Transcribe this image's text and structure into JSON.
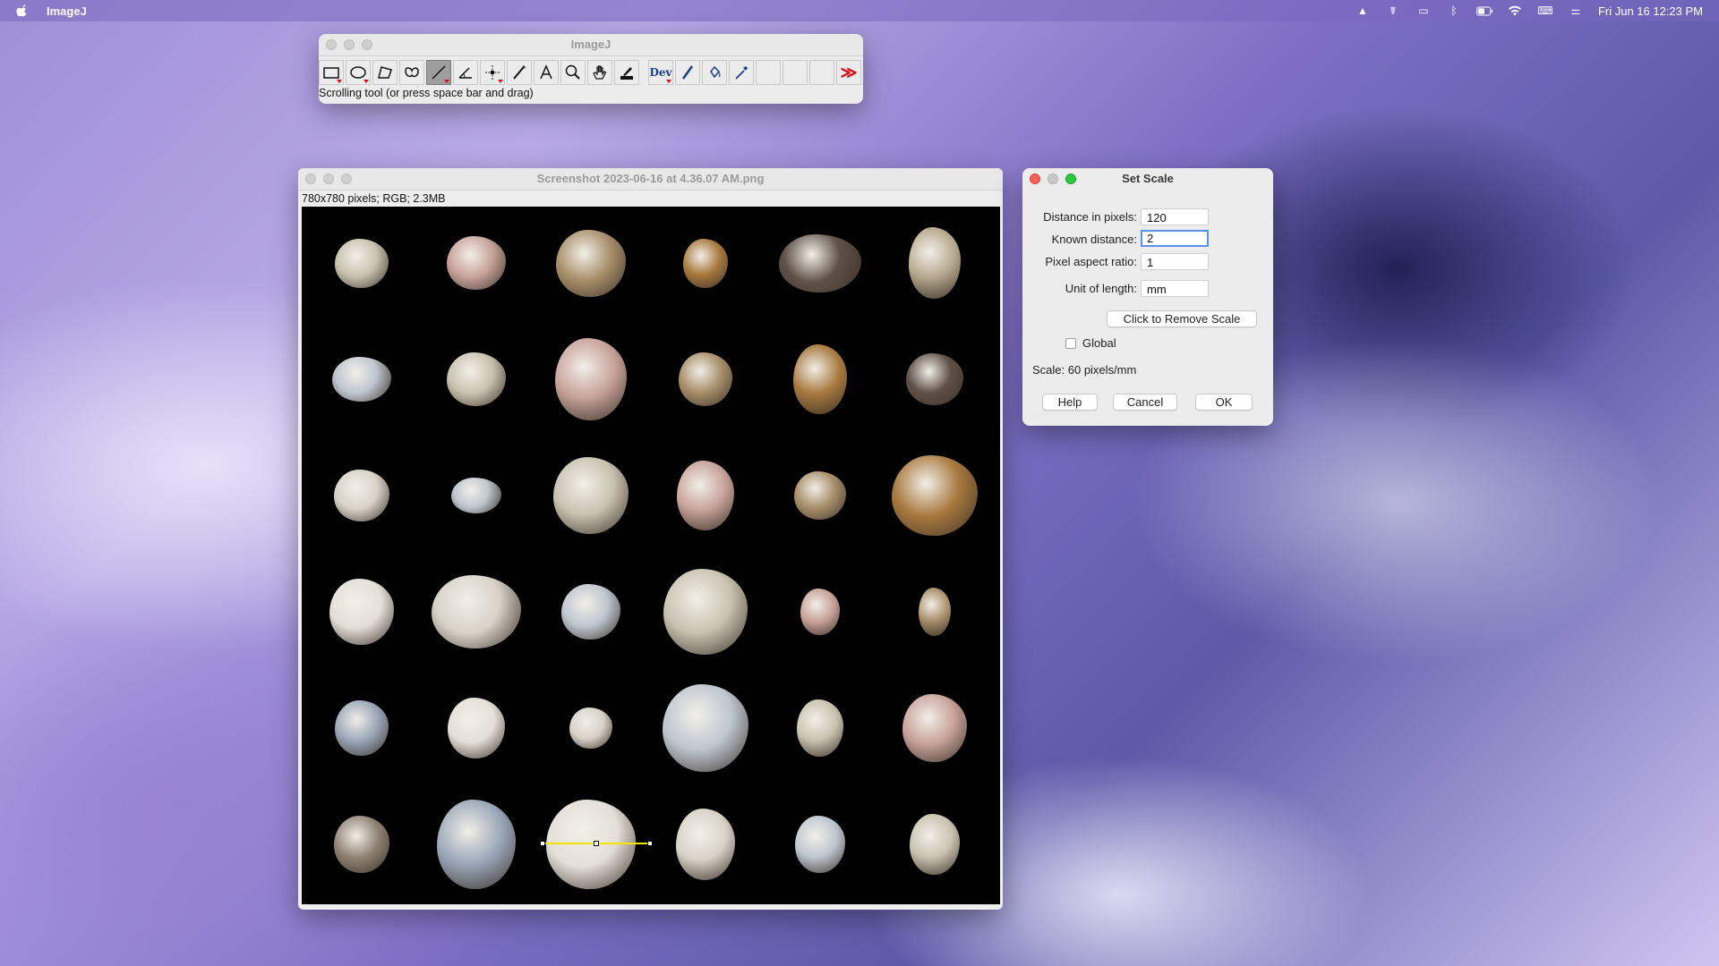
{
  "menubar": {
    "app_name": "ImageJ",
    "clock": "Fri Jun 16  12:23 PM",
    "icons": [
      "scale-icon",
      "spotlight-person-icon",
      "display-icon",
      "bluetooth-icon",
      "battery-icon",
      "wifi-icon",
      "keyboard-icon",
      "control-center-icon"
    ]
  },
  "toolbar_window": {
    "title": "ImageJ",
    "dev_label": "Dev",
    "more_label": "≫",
    "status": "Scrolling tool (or press space bar and drag)",
    "tools": [
      "rectangle-tool",
      "oval-tool",
      "polygon-tool",
      "freehand-tool",
      "line-tool",
      "angle-tool",
      "point-tool",
      "wand-tool",
      "text-tool",
      "magnifier-tool",
      "hand-tool",
      "color-picker-tool",
      "dev-tool",
      "brush-tool",
      "flood-fill-tool",
      "pipette-tool",
      "empty-slot",
      "empty-slot",
      "empty-slot",
      "more-tools"
    ]
  },
  "image_window": {
    "title": "Screenshot 2023-06-16 at 4.36.07 AM.png",
    "info": "780x780 pixels; RGB; 2.3MB"
  },
  "set_scale": {
    "title": "Set Scale",
    "distance_label": "Distance in pixels:",
    "distance_value": "120",
    "known_label": "Known distance:",
    "known_value": "2",
    "aspect_label": "Pixel aspect ratio:",
    "aspect_value": "1",
    "unit_label": "Unit of length:",
    "unit_value": "mm",
    "remove_button": "Click to Remove Scale",
    "global_label": "Global",
    "global_checked": false,
    "scale_text": "Scale: 60 pixels/mm",
    "help_button": "Help",
    "cancel_button": "Cancel",
    "ok_button": "OK"
  },
  "colors": {
    "selected_tool": "#9e9e9e",
    "close_red": "#ff5f57",
    "zoom_green": "#28c840",
    "measure_line": "#f2e400",
    "focus_ring": "#5b8ff0"
  }
}
